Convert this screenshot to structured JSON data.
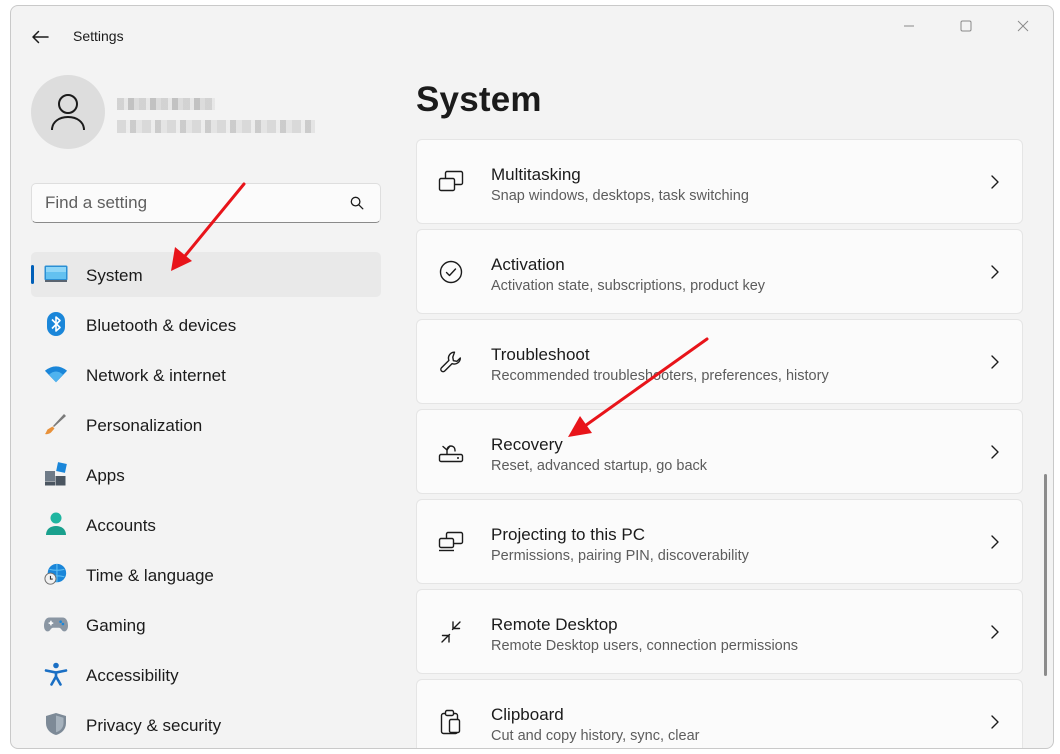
{
  "window": {
    "title": "Settings"
  },
  "search": {
    "placeholder": "Find a setting"
  },
  "sidebar": {
    "items": [
      {
        "label": "System",
        "icon": "monitor-icon",
        "active": true
      },
      {
        "label": "Bluetooth & devices",
        "icon": "bluetooth-icon"
      },
      {
        "label": "Network & internet",
        "icon": "wifi-icon"
      },
      {
        "label": "Personalization",
        "icon": "paintbrush-icon"
      },
      {
        "label": "Apps",
        "icon": "apps-icon"
      },
      {
        "label": "Accounts",
        "icon": "person-icon"
      },
      {
        "label": "Time & language",
        "icon": "globe-clock-icon"
      },
      {
        "label": "Gaming",
        "icon": "gamepad-icon"
      },
      {
        "label": "Accessibility",
        "icon": "accessibility-icon"
      },
      {
        "label": "Privacy & security",
        "icon": "shield-icon"
      }
    ]
  },
  "main": {
    "title": "System",
    "cards": [
      {
        "title": "Multitasking",
        "subtitle": "Snap windows, desktops, task switching",
        "icon": "multitasking-icon"
      },
      {
        "title": "Activation",
        "subtitle": "Activation state, subscriptions, product key",
        "icon": "check-circle-icon"
      },
      {
        "title": "Troubleshoot",
        "subtitle": "Recommended troubleshooters, preferences, history",
        "icon": "wrench-icon"
      },
      {
        "title": "Recovery",
        "subtitle": "Reset, advanced startup, go back",
        "icon": "recovery-icon"
      },
      {
        "title": "Projecting to this PC",
        "subtitle": "Permissions, pairing PIN, discoverability",
        "icon": "projecting-icon"
      },
      {
        "title": "Remote Desktop",
        "subtitle": "Remote Desktop users, connection permissions",
        "icon": "remote-desktop-icon"
      },
      {
        "title": "Clipboard",
        "subtitle": "Cut and copy history, sync, clear",
        "icon": "clipboard-icon"
      }
    ]
  },
  "colors": {
    "accent": "#005fb8",
    "annotation_arrow": "#e8141a",
    "window_bg": "#f3f3f3",
    "card_bg": "#fbfbfb"
  }
}
